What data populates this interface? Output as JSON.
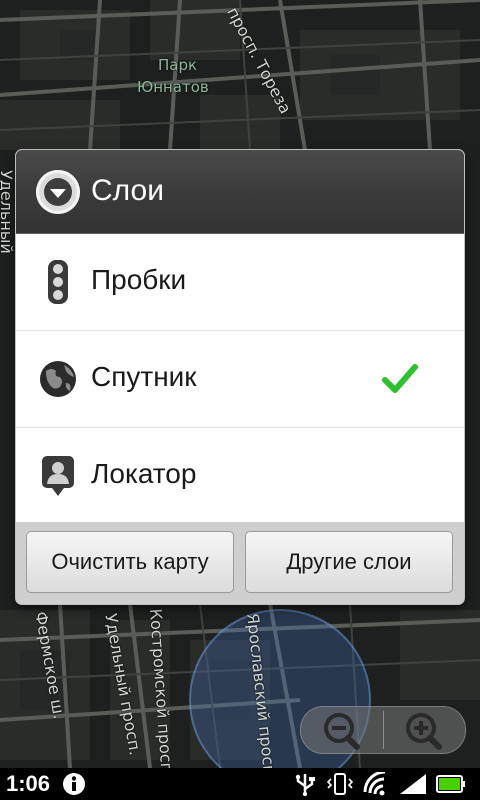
{
  "map": {
    "park_label_line1": "Парк",
    "park_label_line2": "Юннатов",
    "streets": {
      "torez": "просп. Тореза",
      "kostromskoy": "Костромской просп.",
      "udelny_1": "Удельный просп.",
      "fermskoe": "Фермское ш.",
      "yaroslavsky": "Ярославский просп.",
      "udelny_left": "Удельный"
    }
  },
  "dialog": {
    "title": "Слои",
    "items": [
      {
        "label": "Пробки",
        "icon": "traffic-light-icon",
        "checked": false
      },
      {
        "label": "Спутник",
        "icon": "globe-icon",
        "checked": true
      },
      {
        "label": "Локатор",
        "icon": "latitude-person-icon",
        "checked": false
      }
    ],
    "buttons": {
      "clear_label": "Очистить карту",
      "more_label": "Другие слои"
    },
    "check_color": "#2fbf2f"
  },
  "status_bar": {
    "time": "1:06",
    "icons": [
      "info-icon",
      "usb-icon",
      "vibrate-icon",
      "wifi-icon",
      "signal-icon",
      "battery-icon"
    ],
    "battery_color": "#4ad000"
  }
}
